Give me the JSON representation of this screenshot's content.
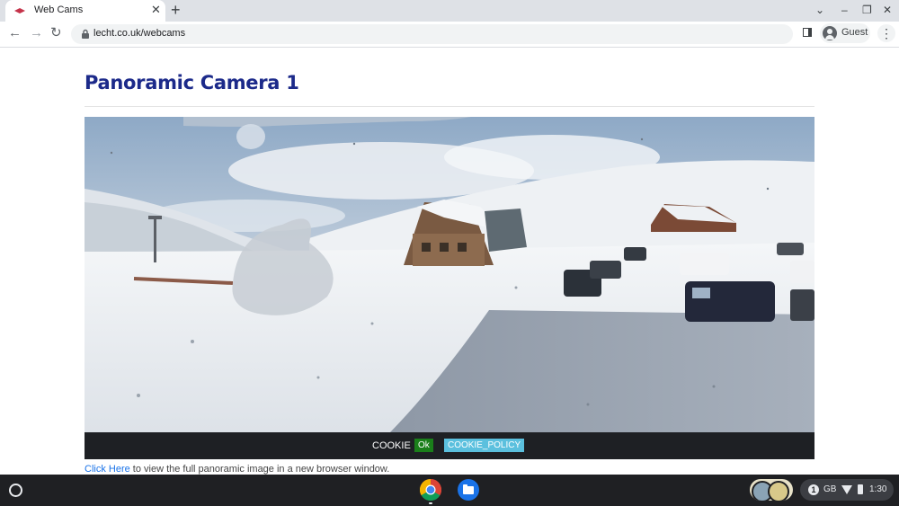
{
  "browser": {
    "tab_title": "Web Cams",
    "tab_close": "✕",
    "new_tab": "+",
    "url": "lecht.co.uk/webcams",
    "profile_label": "Guest",
    "nav": {
      "back": "←",
      "forward": "→",
      "reload": "↻"
    },
    "window_controls": {
      "tab_search": "⌄",
      "minimize": "–",
      "restore": "❐",
      "close": "✕"
    },
    "menu": "⋮",
    "icons": [
      "favicon",
      "back-arrow-icon",
      "forward-arrow-icon",
      "reload-icon",
      "lock-icon",
      "side-panel-icon",
      "avatar-icon",
      "kebab-menu-icon"
    ]
  },
  "page": {
    "title": "Panoramic Camera 1",
    "webcam_image": "panoramic snowy ski centre webcam",
    "cookie": {
      "text": "COOKIE",
      "ok": "Ok",
      "policy": "COOKIE_POLICY"
    },
    "caption": {
      "link": "Click Here",
      "text": " to view the full panoramic image in a new browser window."
    }
  },
  "shelf": {
    "apps": [
      "chrome-icon",
      "files-icon"
    ],
    "tray": {
      "notifications": "1",
      "network": "GB",
      "time": "1:30"
    }
  },
  "colors": {
    "title": "#1c2a8a",
    "link": "#1a73e8",
    "cookie_ok": "#1a7f1a",
    "cookie_policy": "#5bc0de",
    "cookie_bar": "#1e2024"
  }
}
